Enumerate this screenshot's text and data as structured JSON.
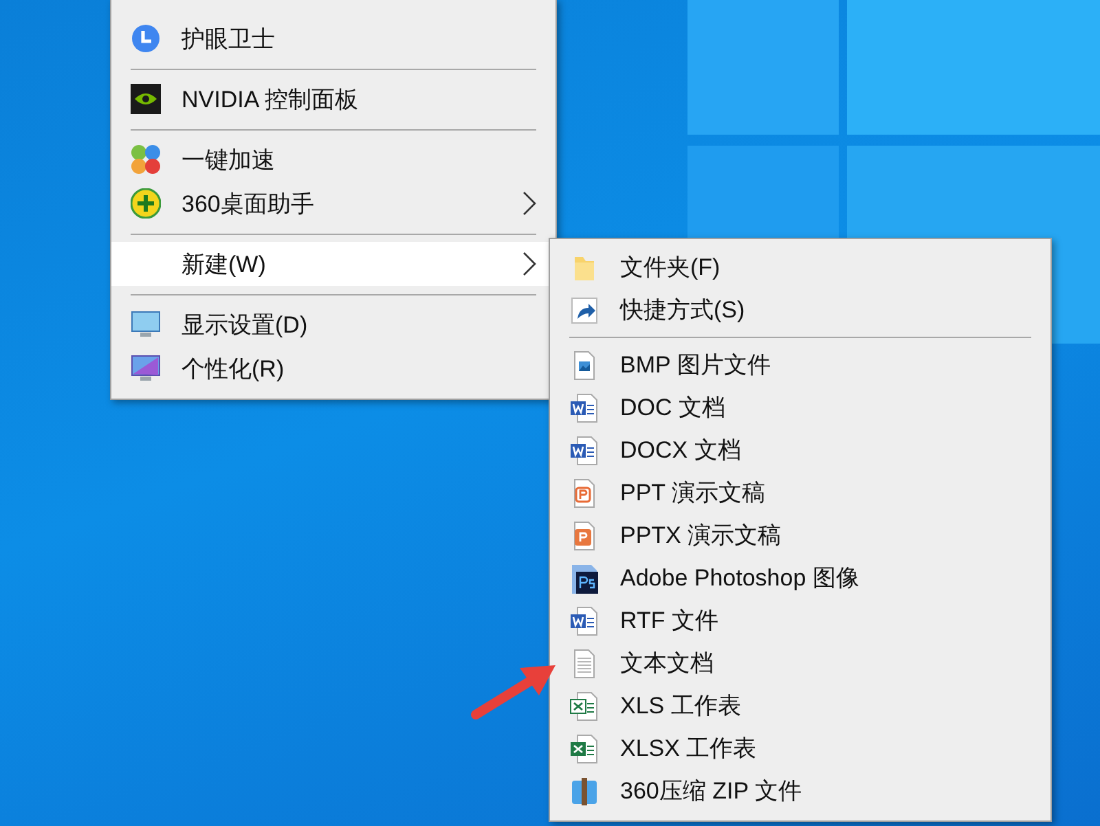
{
  "context_menu": {
    "items": [
      {
        "kind": "eye-care",
        "label": "护眼卫士",
        "has_submenu": false,
        "selected": false
      },
      {
        "kind": "separator"
      },
      {
        "kind": "gpu-panel",
        "label": "NVIDIA 控制面板",
        "has_submenu": false,
        "selected": false
      },
      {
        "kind": "separator"
      },
      {
        "kind": "speedup",
        "label": "一键加速",
        "has_submenu": false,
        "selected": false
      },
      {
        "kind": "desk-helper",
        "label": "360桌面助手",
        "has_submenu": true,
        "selected": false
      },
      {
        "kind": "separator"
      },
      {
        "kind": "plain",
        "label": "新建(W)",
        "has_submenu": true,
        "selected": true
      },
      {
        "kind": "separator"
      },
      {
        "kind": "display",
        "label": "显示设置(D)",
        "has_submenu": false,
        "selected": false
      },
      {
        "kind": "personalize",
        "label": "个性化(R)",
        "has_submenu": false,
        "selected": false
      }
    ]
  },
  "new_submenu": {
    "items": [
      {
        "kind": "folder",
        "label": "文件夹(F)",
        "selected": false
      },
      {
        "kind": "shortcut",
        "label": "快捷方式(S)",
        "selected": false
      },
      {
        "kind": "separator"
      },
      {
        "kind": "bitmap",
        "label": "BMP 图片文件",
        "selected": false
      },
      {
        "kind": "word",
        "label": "DOC 文档",
        "selected": false
      },
      {
        "kind": "word",
        "label": "DOCX 文档",
        "selected": false
      },
      {
        "kind": "slides",
        "label": "PPT 演示文稿",
        "selected": false
      },
      {
        "kind": "slides-x",
        "label": "PPTX 演示文稿",
        "selected": false
      },
      {
        "kind": "psd",
        "label": "Adobe Photoshop 图像",
        "selected": false
      },
      {
        "kind": "word",
        "label": "RTF 文件",
        "selected": false
      },
      {
        "kind": "text",
        "label": "文本文档",
        "selected": false
      },
      {
        "kind": "sheet",
        "label": "XLS 工作表",
        "selected": false
      },
      {
        "kind": "sheet-x",
        "label": "XLSX 工作表",
        "selected": false
      },
      {
        "kind": "zip",
        "label": "360压缩 ZIP 文件",
        "selected": false
      }
    ]
  }
}
